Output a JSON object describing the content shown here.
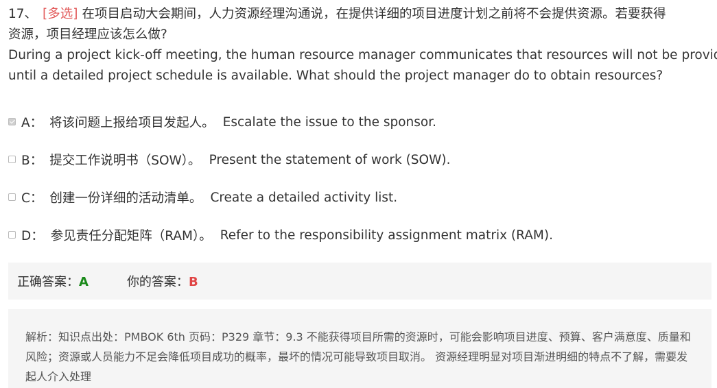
{
  "question": {
    "number": "17、",
    "type_tag": "[多选]",
    "cn_line1": "在项目启动大会期间，人力资源经理沟通说，在提供详细的项目进度计划之前将不会提供资源。若要获得",
    "cn_line2": "资源，项目经理应该怎么做?",
    "en_line1": "During a project kick-off meeting, the human resource manager communicates that resources will not be provided",
    "en_line2": "until a detailed project schedule is available. What should the project manager do to obtain resources?"
  },
  "options": [
    {
      "letter": "A：",
      "cn": "将该问题上报给项目发起人。",
      "en": "Escalate the issue to the sponsor.",
      "checked": true
    },
    {
      "letter": "B：",
      "cn": "提交工作说明书（SOW）。",
      "en": "Present the statement of work (SOW).",
      "checked": false
    },
    {
      "letter": "C：",
      "cn": "创建一份详细的活动清单。",
      "en": "Create a detailed activity list.",
      "checked": false
    },
    {
      "letter": "D：",
      "cn": "参见责任分配矩阵（RAM）。",
      "en": "Refer to the responsibility assignment matrix (RAM).",
      "checked": false
    }
  ],
  "answer": {
    "correct_label": "正确答案：",
    "correct_value": "A",
    "yours_label": "你的答案：",
    "yours_value": "B",
    "correct_color": "#1a8a1a",
    "wrong_color": "#e04545"
  },
  "analysis": {
    "text": "解析：知识点出处：PMBOK 6th 页码：P329 章节：9.3 不能获得项目所需的资源时，可能会影响项目进度、预算、客户满意度、质量和风险；资源或人员能力不足会降低项目成功的概率，最坏的情况可能导致项目取消。 资源经理明显对项目渐进明细的特点不了解，需要发起人介入处理"
  }
}
